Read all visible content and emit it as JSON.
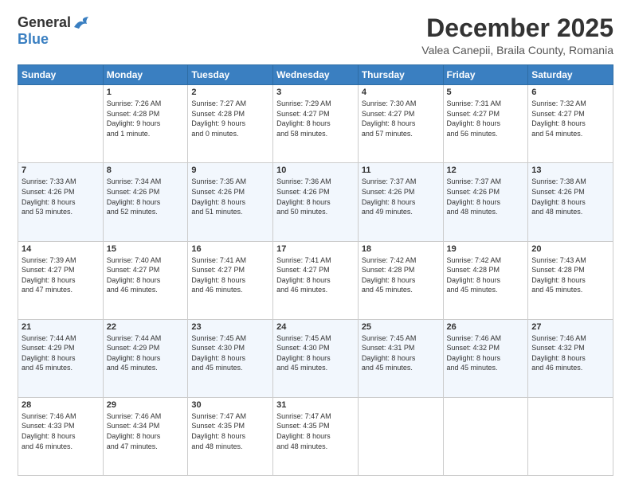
{
  "logo": {
    "general": "General",
    "blue": "Blue"
  },
  "title": "December 2025",
  "subtitle": "Valea Canepii, Braila County, Romania",
  "days_of_week": [
    "Sunday",
    "Monday",
    "Tuesday",
    "Wednesday",
    "Thursday",
    "Friday",
    "Saturday"
  ],
  "weeks": [
    [
      {
        "day": "",
        "info": ""
      },
      {
        "day": "1",
        "info": "Sunrise: 7:26 AM\nSunset: 4:28 PM\nDaylight: 9 hours\nand 1 minute."
      },
      {
        "day": "2",
        "info": "Sunrise: 7:27 AM\nSunset: 4:28 PM\nDaylight: 9 hours\nand 0 minutes."
      },
      {
        "day": "3",
        "info": "Sunrise: 7:29 AM\nSunset: 4:27 PM\nDaylight: 8 hours\nand 58 minutes."
      },
      {
        "day": "4",
        "info": "Sunrise: 7:30 AM\nSunset: 4:27 PM\nDaylight: 8 hours\nand 57 minutes."
      },
      {
        "day": "5",
        "info": "Sunrise: 7:31 AM\nSunset: 4:27 PM\nDaylight: 8 hours\nand 56 minutes."
      },
      {
        "day": "6",
        "info": "Sunrise: 7:32 AM\nSunset: 4:27 PM\nDaylight: 8 hours\nand 54 minutes."
      }
    ],
    [
      {
        "day": "7",
        "info": "Sunrise: 7:33 AM\nSunset: 4:26 PM\nDaylight: 8 hours\nand 53 minutes."
      },
      {
        "day": "8",
        "info": "Sunrise: 7:34 AM\nSunset: 4:26 PM\nDaylight: 8 hours\nand 52 minutes."
      },
      {
        "day": "9",
        "info": "Sunrise: 7:35 AM\nSunset: 4:26 PM\nDaylight: 8 hours\nand 51 minutes."
      },
      {
        "day": "10",
        "info": "Sunrise: 7:36 AM\nSunset: 4:26 PM\nDaylight: 8 hours\nand 50 minutes."
      },
      {
        "day": "11",
        "info": "Sunrise: 7:37 AM\nSunset: 4:26 PM\nDaylight: 8 hours\nand 49 minutes."
      },
      {
        "day": "12",
        "info": "Sunrise: 7:37 AM\nSunset: 4:26 PM\nDaylight: 8 hours\nand 48 minutes."
      },
      {
        "day": "13",
        "info": "Sunrise: 7:38 AM\nSunset: 4:26 PM\nDaylight: 8 hours\nand 48 minutes."
      }
    ],
    [
      {
        "day": "14",
        "info": "Sunrise: 7:39 AM\nSunset: 4:27 PM\nDaylight: 8 hours\nand 47 minutes."
      },
      {
        "day": "15",
        "info": "Sunrise: 7:40 AM\nSunset: 4:27 PM\nDaylight: 8 hours\nand 46 minutes."
      },
      {
        "day": "16",
        "info": "Sunrise: 7:41 AM\nSunset: 4:27 PM\nDaylight: 8 hours\nand 46 minutes."
      },
      {
        "day": "17",
        "info": "Sunrise: 7:41 AM\nSunset: 4:27 PM\nDaylight: 8 hours\nand 46 minutes."
      },
      {
        "day": "18",
        "info": "Sunrise: 7:42 AM\nSunset: 4:28 PM\nDaylight: 8 hours\nand 45 minutes."
      },
      {
        "day": "19",
        "info": "Sunrise: 7:42 AM\nSunset: 4:28 PM\nDaylight: 8 hours\nand 45 minutes."
      },
      {
        "day": "20",
        "info": "Sunrise: 7:43 AM\nSunset: 4:28 PM\nDaylight: 8 hours\nand 45 minutes."
      }
    ],
    [
      {
        "day": "21",
        "info": "Sunrise: 7:44 AM\nSunset: 4:29 PM\nDaylight: 8 hours\nand 45 minutes."
      },
      {
        "day": "22",
        "info": "Sunrise: 7:44 AM\nSunset: 4:29 PM\nDaylight: 8 hours\nand 45 minutes."
      },
      {
        "day": "23",
        "info": "Sunrise: 7:45 AM\nSunset: 4:30 PM\nDaylight: 8 hours\nand 45 minutes."
      },
      {
        "day": "24",
        "info": "Sunrise: 7:45 AM\nSunset: 4:30 PM\nDaylight: 8 hours\nand 45 minutes."
      },
      {
        "day": "25",
        "info": "Sunrise: 7:45 AM\nSunset: 4:31 PM\nDaylight: 8 hours\nand 45 minutes."
      },
      {
        "day": "26",
        "info": "Sunrise: 7:46 AM\nSunset: 4:32 PM\nDaylight: 8 hours\nand 45 minutes."
      },
      {
        "day": "27",
        "info": "Sunrise: 7:46 AM\nSunset: 4:32 PM\nDaylight: 8 hours\nand 46 minutes."
      }
    ],
    [
      {
        "day": "28",
        "info": "Sunrise: 7:46 AM\nSunset: 4:33 PM\nDaylight: 8 hours\nand 46 minutes."
      },
      {
        "day": "29",
        "info": "Sunrise: 7:46 AM\nSunset: 4:34 PM\nDaylight: 8 hours\nand 47 minutes."
      },
      {
        "day": "30",
        "info": "Sunrise: 7:47 AM\nSunset: 4:35 PM\nDaylight: 8 hours\nand 48 minutes."
      },
      {
        "day": "31",
        "info": "Sunrise: 7:47 AM\nSunset: 4:35 PM\nDaylight: 8 hours\nand 48 minutes."
      },
      {
        "day": "",
        "info": ""
      },
      {
        "day": "",
        "info": ""
      },
      {
        "day": "",
        "info": ""
      }
    ]
  ]
}
